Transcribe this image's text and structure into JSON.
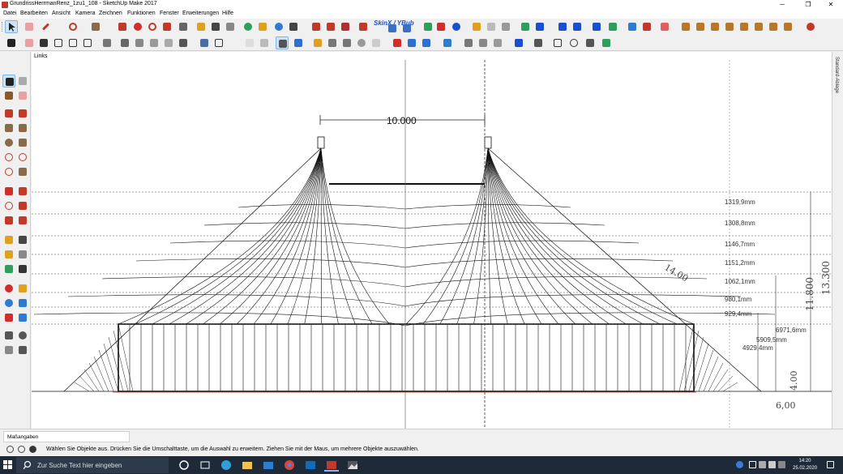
{
  "window": {
    "title": "GrundrissHerrmanRenz_1zu1_108 - SketchUp Make 2017",
    "minimize_icon": "─",
    "maximize_icon": "❐",
    "close_icon": "✕"
  },
  "menu": [
    "Datei",
    "Bearbeiten",
    "Ansicht",
    "Kamera",
    "Zeichnen",
    "Funktionen",
    "Fenster",
    "Erweiterungen",
    "Hilfe"
  ],
  "toolbar": {
    "skin_label": "SkinX / YBub",
    "colors": {
      "select": "#1d1d1d",
      "eraser": "#e07a7a",
      "pencil": "#c0392b",
      "paint": "#8b5a2b",
      "orbit": "#d12d2d",
      "zoom": "#2e7bd1",
      "scenes": "#e0a020",
      "section": "#4a4a4a",
      "solid": "#2f6fd0",
      "warehouse": "#c0392b",
      "sandbox": "#2e9e5b",
      "extension": "#b9772a"
    }
  },
  "viewport": {
    "scene_label": "Links",
    "scale_text": "10.000",
    "sketch_text_diag": "14.00",
    "sketch_text_right1": "11.800",
    "sketch_text_right2": "13.300",
    "sketch_text_bottom": "6,00",
    "sketch_text_base": "4.00",
    "dimensions": [
      "1319,9mm",
      "1308,8mm",
      "1146,7mm",
      "1151,2mm",
      "1062,1mm",
      "980,1mm",
      "929,4mm",
      "6971,6mm",
      "5909,5mm",
      "4929,4mm"
    ]
  },
  "tray": {
    "label": "Standard-Ablage"
  },
  "measurements": {
    "label": "Maßangaben"
  },
  "status": {
    "text": "Wählen Sie Objekte aus. Drücken Sie die Umschalttaste, um die Auswahl zu erweitern. Ziehen Sie mit der Maus, um mehrere Objekte auszuwählen."
  },
  "taskbar": {
    "search_placeholder": "Zur Suche Text hier eingeben",
    "time": "14:20",
    "date": "25.02.2020"
  }
}
